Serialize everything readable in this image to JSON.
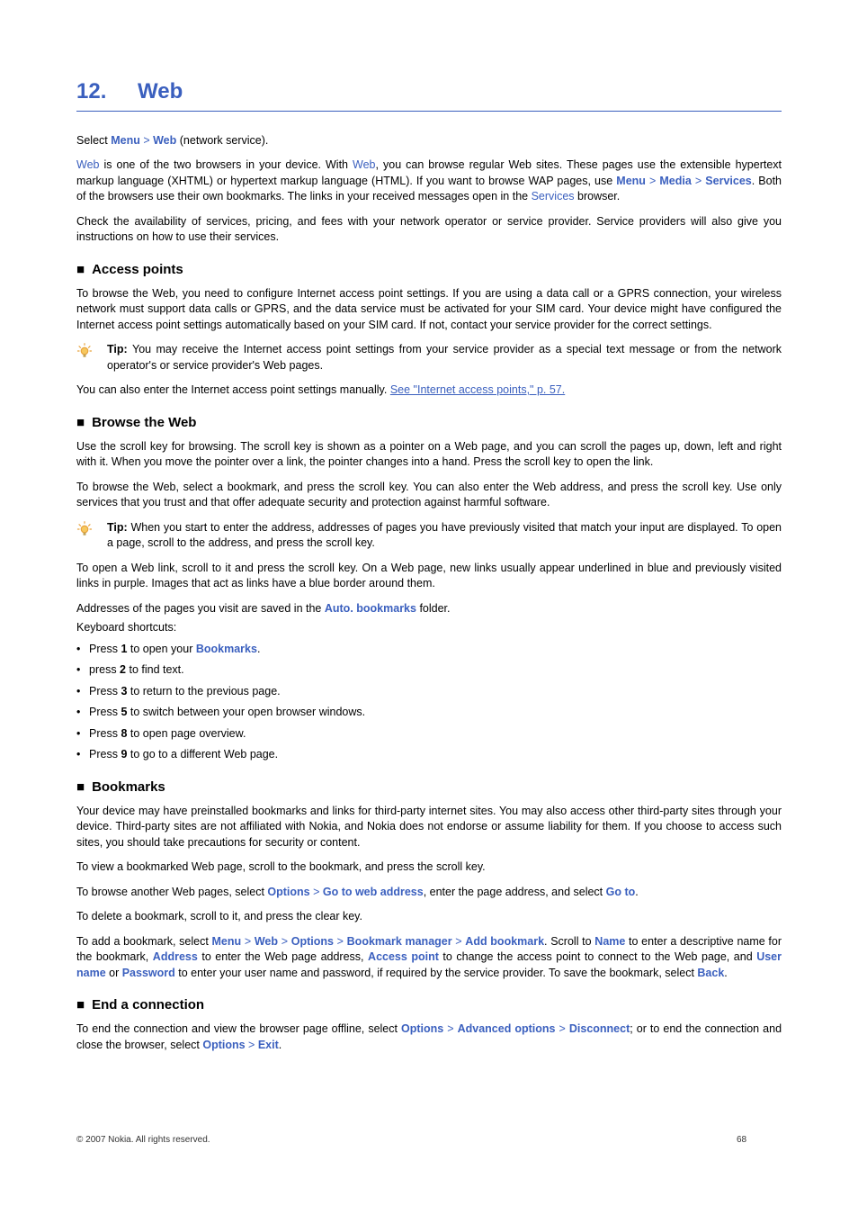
{
  "chapter": {
    "num": "12.",
    "title": "Web"
  },
  "intro": {
    "p1_a": "Select ",
    "p1_menu": "Menu",
    "p1_gt1": " > ",
    "p1_web": "Web",
    "p1_b": " (network service).",
    "p2_a": "",
    "p2_web1": "Web",
    "p2_b": " is one of the two browsers in your device. With ",
    "p2_web2": "Web",
    "p2_c": ", you can browse regular Web sites. These pages use the extensible hypertext markup language (XHTML) or hypertext markup language (HTML). If you want to browse WAP pages, use ",
    "p2_menu": "Menu",
    "p2_gt1": " > ",
    "p2_media": "Media",
    "p2_gt2": " > ",
    "p2_services1": "Services",
    "p2_d": ". Both of the browsers use their own bookmarks. The links in your received messages open in the ",
    "p2_services2": "Services",
    "p2_e": " browser.",
    "p3": "Check the availability of services, pricing, and fees with your network operator or service provider. Service providers will also give you instructions on how to use their services."
  },
  "access": {
    "title": "Access points",
    "p1": "To browse the Web, you need to configure Internet access point settings. If you are using a data call or a GPRS connection, your wireless network must support data calls or GPRS, and the data service must be activated for your SIM card. Your device might have configured the Internet access point settings automatically based on your SIM card. If not, contact your service provider for the correct settings.",
    "tip_label": "Tip: ",
    "tip_body": "You may receive the Internet access point settings from your service provider as a special text message or from the network operator's or service provider's Web pages.",
    "p2_a": "You can also enter the Internet access point settings manually. ",
    "p2_link": "See \"Internet access points,\" p. 57."
  },
  "browse": {
    "title": "Browse the Web",
    "p1": "Use the scroll key for browsing. The scroll key is shown as a pointer on a Web page, and you can scroll the pages up, down, left and right with it. When you move the pointer over a link, the pointer changes into a hand. Press the scroll key to open the link.",
    "p2": "To browse the Web, select a bookmark, and press the scroll key. You can also enter the Web address, and press the scroll key. Use only services that you trust and that offer adequate security and protection against harmful software.",
    "tip_label": "Tip: ",
    "tip_body": "When you start to enter the address, addresses of pages you have previously visited that match your input are displayed. To open a page, scroll to the address, and press the scroll key.",
    "p3": "To open a Web link, scroll to it and press the scroll key. On a Web page, new links usually appear underlined in blue and previously visited links in purple. Images that act as links have a blue border around them.",
    "p4_a": "Addresses of the pages you visit are saved in the ",
    "p4_auto": "Auto. bookmarks",
    "p4_b": " folder.",
    "p5": "Keyboard shortcuts:",
    "items": [
      {
        "a": "Press ",
        "k": "1",
        "b": " to open your ",
        "ui": "Bookmarks",
        "c": "."
      },
      {
        "a": "press ",
        "k": "2",
        "b": " to find text.",
        "ui": "",
        "c": ""
      },
      {
        "a": "Press ",
        "k": "3",
        "b": " to return to the previous page.",
        "ui": "",
        "c": ""
      },
      {
        "a": "Press ",
        "k": "5",
        "b": " to switch between your open browser windows.",
        "ui": "",
        "c": ""
      },
      {
        "a": "Press ",
        "k": "8",
        "b": " to open page overview.",
        "ui": "",
        "c": ""
      },
      {
        "a": "Press ",
        "k": "9",
        "b": " to go to a different Web page.",
        "ui": "",
        "c": ""
      }
    ]
  },
  "bookmarks": {
    "title": "Bookmarks",
    "p1": "Your device may have preinstalled bookmarks and links for third-party internet sites. You may also access other third-party sites through your device. Third-party sites are not affiliated with Nokia, and Nokia does not endorse or assume liability for them. If you choose to access such sites, you should take precautions for security or content.",
    "p2": "To view a bookmarked Web page, scroll to the bookmark, and press the scroll key.",
    "p3_a": "To browse another Web pages, select ",
    "p3_opt": "Options",
    "p3_gt": " > ",
    "p3_goto": "Go to web address",
    "p3_b": ", enter the page address, and select ",
    "p3_goto2": "Go to",
    "p3_c": ".",
    "p4": "To delete a bookmark, scroll to it, and press the clear key.",
    "p5_a": "To add a bookmark, select ",
    "p5_menu": "Menu",
    "p5_gt1": " > ",
    "p5_web": "Web",
    "p5_gt2": " > ",
    "p5_opt": "Options",
    "p5_gt3": " > ",
    "p5_bmm": "Bookmark manager",
    "p5_gt4": " > ",
    "p5_add": "Add bookmark",
    "p5_b": ". Scroll to ",
    "p5_name": "Name",
    "p5_c": " to enter a descriptive name for the bookmark, ",
    "p5_addr": "Address",
    "p5_d": " to enter the Web page address, ",
    "p5_ap": "Access point",
    "p5_e": " to change the access point to connect to the Web page, and ",
    "p5_user": "User name",
    "p5_f": " or ",
    "p5_pw": "Password",
    "p5_g": " to enter your user name and password, if required by the service provider. To save the bookmark, select ",
    "p5_back": "Back",
    "p5_h": "."
  },
  "end": {
    "title": "End a connection",
    "p1_a": "To end the connection and view the browser page offline, select ",
    "p1_opt": "Options",
    "p1_gt1": " > ",
    "p1_adv": "Advanced options",
    "p1_gt2": " > ",
    "p1_disc": "Disconnect",
    "p1_b": "; or to end the connection and close the browser, select ",
    "p1_opt2": "Options",
    "p1_gt3": " > ",
    "p1_exit": "Exit",
    "p1_c": "."
  },
  "footer": {
    "copy": "© 2007 Nokia. All rights reserved.",
    "page": "68"
  }
}
